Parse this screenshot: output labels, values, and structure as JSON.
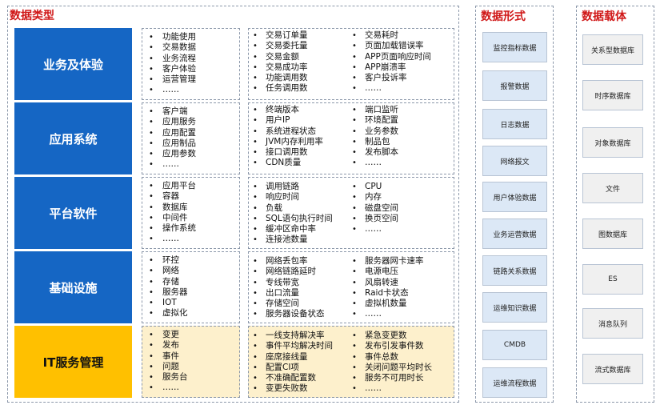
{
  "panels": {
    "data_types": "数据类型",
    "data_forms": "数据形式",
    "data_carriers": "数据载体"
  },
  "categories": [
    {
      "name": "业务及体验",
      "col1": [
        "功能使用",
        "交易数据",
        "业务流程",
        "客户体验",
        "运营管理",
        "……"
      ],
      "col2": [
        "交易订单量",
        "交易委托量",
        "交易金额",
        "交易成功率",
        "功能调用数",
        "任务调用数"
      ],
      "col3": [
        "交易耗时",
        "页面加载错误率",
        "APP页面响应时间",
        "APP崩溃率",
        "客户投诉率",
        "……"
      ]
    },
    {
      "name": "应用系统",
      "col1": [
        "客户端",
        "应用服务",
        "应用配置",
        "应用制品",
        "应用参数",
        "……"
      ],
      "col2": [
        "终端版本",
        "用户IP",
        "系统进程状态",
        "JVM内存利用率",
        "接口调用数",
        "CDN质量"
      ],
      "col3": [
        "端口监听",
        "环境配置",
        "业务参数",
        "制品包",
        "发布脚本",
        "……"
      ]
    },
    {
      "name": "平台软件",
      "col1": [
        "应用平台",
        "容器",
        "数据库",
        "中间件",
        "操作系统",
        "……"
      ],
      "col2": [
        "调用链路",
        "响应时间",
        "负载",
        "SQL语句执行时间",
        "缓冲区命中率",
        "连接池数量"
      ],
      "col3": [
        "CPU",
        "内存",
        "磁盘空间",
        "换页空间",
        "……"
      ]
    },
    {
      "name": "基础设施",
      "col1": [
        "环控",
        "网络",
        "存储",
        "服务器",
        "IOT",
        "虚拟化"
      ],
      "col2": [
        "网络丢包率",
        "网络链路延时",
        "专线带宽",
        "出口流量",
        "存储空间",
        "服务器设备状态"
      ],
      "col3": [
        "服务器网卡速率",
        "电源电压",
        "风扇转速",
        "Raid卡状态",
        "虚拟机数量",
        "……"
      ]
    },
    {
      "name": "IT服务管理",
      "col1": [
        "变更",
        "发布",
        "事件",
        "问题",
        "服务台",
        "……"
      ],
      "col2": [
        "一线支持解决率",
        "事件平均解决时间",
        "座席接线量",
        "配置CI项",
        "不准确配置数",
        "变更失败数"
      ],
      "col3": [
        "紧急变更数",
        "发布引发事件数",
        "事件总数",
        "关闭问题平均时长",
        "服务不可用时长",
        "……"
      ]
    }
  ],
  "data_forms": [
    "监控指标数据",
    "报警数据",
    "日志数据",
    "网络报文",
    "用户体验数据",
    "业务运营数据",
    "链路关系数据",
    "运维知识数据",
    "CMDB",
    "运维流程数据"
  ],
  "data_carriers": [
    "关系型数据库",
    "时序数据库",
    "对象数据库",
    "文件",
    "图数据库",
    "ES",
    "消息队列",
    "流式数据库"
  ],
  "colors": {
    "category_blue": "#1566c4",
    "itsm_gold": "#ffc000",
    "itsm_box_fill": "#fdf0cc",
    "title_red": "#d01818",
    "form_tile_fill": "#dce8f6",
    "carrier_tile_fill": "#f0f0f0"
  }
}
